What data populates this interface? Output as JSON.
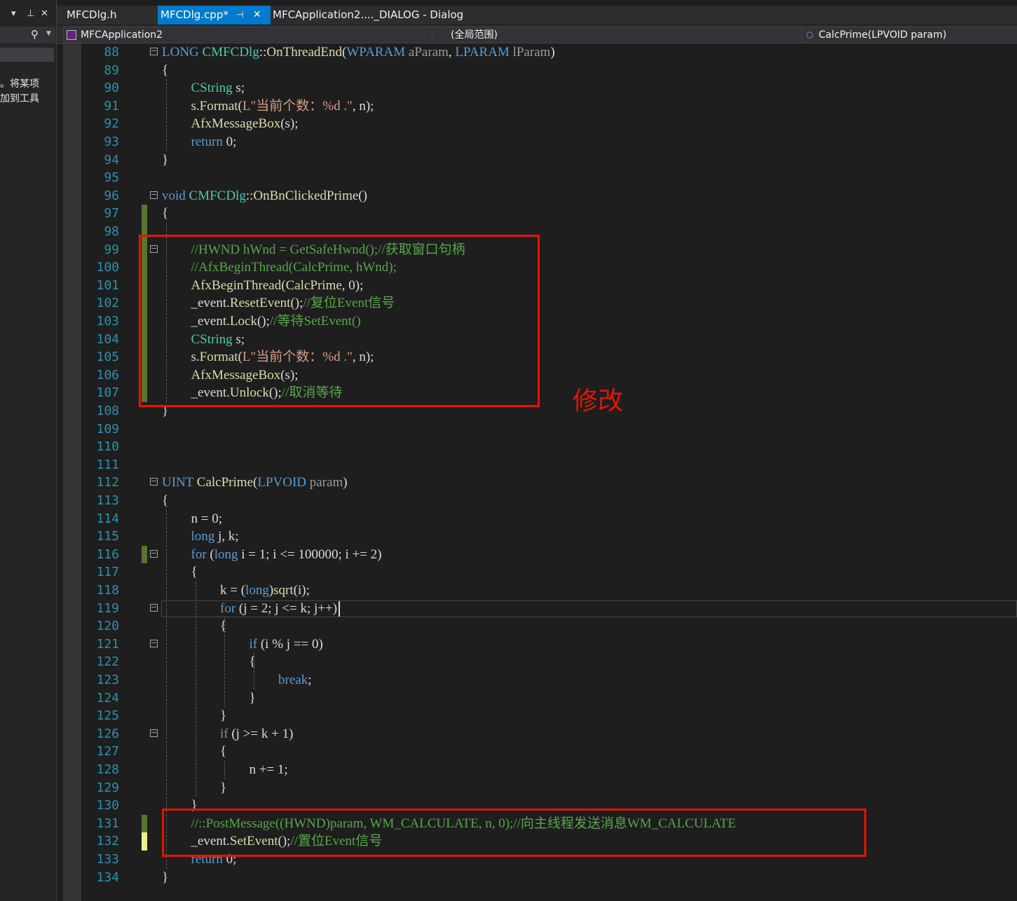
{
  "sidebar": {
    "note_text": "。将某项\n加到工具"
  },
  "tabs": [
    {
      "label": "MFCDlg.h",
      "active": false
    },
    {
      "label": "MFCDlg.cpp*",
      "active": true
    },
    {
      "label": "MFCApplication2...._DIALOG - Dialog",
      "active": false
    }
  ],
  "navbar": {
    "project": "MFCApplication2",
    "scope": "(全局范围)",
    "member": "CalcPrime(LPVOID param)"
  },
  "annotation": {
    "label": "修改",
    "color": "#e51400"
  },
  "colors": {
    "keyword": "#569cd6",
    "type": "#4ec9b0",
    "function": "#dcdcaa",
    "comment": "#57a64a",
    "string": "#d69d85",
    "line_number": "#2b91af",
    "change_saved": "#577430",
    "change_unsaved": "#efef91",
    "accent": "#007acc"
  },
  "code_lines": [
    {
      "n": "88",
      "ind": 0,
      "fold": true,
      "toks": [
        [
          "kw",
          "LONG"
        ],
        [
          "tx",
          " "
        ],
        [
          "ty",
          "CMFCDlg"
        ],
        [
          "tx",
          "::"
        ],
        [
          "fn",
          "OnThreadEnd"
        ],
        [
          "tx",
          "("
        ],
        [
          "kw",
          "WPARAM"
        ],
        [
          "tx",
          " "
        ],
        [
          "pa",
          "aParam"
        ],
        [
          "tx",
          ", "
        ],
        [
          "kw",
          "LPARAM"
        ],
        [
          "tx",
          " "
        ],
        [
          "pa",
          "lParam"
        ],
        [
          "tx",
          ")"
        ]
      ]
    },
    {
      "n": "89",
      "ind": 0,
      "toks": [
        [
          "tx",
          "{"
        ]
      ]
    },
    {
      "n": "90",
      "ind": 1,
      "toks": [
        [
          "ty",
          "CString"
        ],
        [
          "tx",
          " s;"
        ]
      ]
    },
    {
      "n": "91",
      "ind": 1,
      "toks": [
        [
          "tx",
          "s."
        ],
        [
          "fn",
          "Format"
        ],
        [
          "tx",
          "("
        ],
        [
          "st",
          "L\"当前个数：%d .\""
        ],
        [
          "tx",
          ", n);"
        ]
      ]
    },
    {
      "n": "92",
      "ind": 1,
      "toks": [
        [
          "fn",
          "AfxMessageBox"
        ],
        [
          "tx",
          "(s);"
        ]
      ]
    },
    {
      "n": "93",
      "ind": 1,
      "toks": [
        [
          "kw",
          "return"
        ],
        [
          "tx",
          " 0;"
        ]
      ]
    },
    {
      "n": "94",
      "ind": 0,
      "toks": [
        [
          "tx",
          "}"
        ]
      ]
    },
    {
      "n": "95",
      "ind": 0,
      "toks": []
    },
    {
      "n": "96",
      "ind": 0,
      "fold": true,
      "toks": [
        [
          "kw",
          "void"
        ],
        [
          "tx",
          " "
        ],
        [
          "ty",
          "CMFCDlg"
        ],
        [
          "tx",
          "::"
        ],
        [
          "fn",
          "OnBnClickedPrime"
        ],
        [
          "tx",
          "()"
        ]
      ]
    },
    {
      "n": "97",
      "ind": 0,
      "chg": "saved",
      "toks": [
        [
          "tx",
          "{"
        ]
      ]
    },
    {
      "n": "98",
      "ind": 1,
      "chg": "saved",
      "toks": []
    },
    {
      "n": "99",
      "ind": 1,
      "chg": "saved",
      "fold": true,
      "toks": [
        [
          "cm",
          "//HWND hWnd = GetSafeHwnd();//获取窗口句柄"
        ]
      ]
    },
    {
      "n": "100",
      "ind": 1,
      "chg": "saved",
      "toks": [
        [
          "cm",
          "//AfxBeginThread(CalcPrime, hWnd);"
        ]
      ]
    },
    {
      "n": "101",
      "ind": 1,
      "chg": "saved",
      "toks": [
        [
          "fn",
          "AfxBeginThread"
        ],
        [
          "tx",
          "("
        ],
        [
          "fn",
          "CalcPrime"
        ],
        [
          "tx",
          ", 0);"
        ]
      ]
    },
    {
      "n": "102",
      "ind": 1,
      "chg": "saved",
      "toks": [
        [
          "tx",
          "_event."
        ],
        [
          "fn",
          "ResetEvent"
        ],
        [
          "tx",
          "();"
        ],
        [
          "cm",
          "//复位Event信号"
        ]
      ]
    },
    {
      "n": "103",
      "ind": 1,
      "chg": "saved",
      "toks": [
        [
          "tx",
          "_event."
        ],
        [
          "fn",
          "Lock"
        ],
        [
          "tx",
          "();"
        ],
        [
          "cm",
          "//等待SetEvent()"
        ]
      ]
    },
    {
      "n": "104",
      "ind": 1,
      "chg": "saved",
      "toks": [
        [
          "ty",
          "CString"
        ],
        [
          "tx",
          " s;"
        ]
      ]
    },
    {
      "n": "105",
      "ind": 1,
      "chg": "saved",
      "toks": [
        [
          "tx",
          "s."
        ],
        [
          "fn",
          "Format"
        ],
        [
          "tx",
          "("
        ],
        [
          "st",
          "L\"当前个数：%d .\""
        ],
        [
          "tx",
          ", n);"
        ]
      ]
    },
    {
      "n": "106",
      "ind": 1,
      "chg": "saved",
      "toks": [
        [
          "fn",
          "AfxMessageBox"
        ],
        [
          "tx",
          "(s);"
        ]
      ]
    },
    {
      "n": "107",
      "ind": 1,
      "chg": "saved",
      "toks": [
        [
          "tx",
          "_event."
        ],
        [
          "fn",
          "Unlock"
        ],
        [
          "tx",
          "();"
        ],
        [
          "cm",
          "//取消等待"
        ]
      ]
    },
    {
      "n": "108",
      "ind": 0,
      "toks": [
        [
          "tx",
          "}"
        ]
      ]
    },
    {
      "n": "109",
      "ind": 0,
      "toks": []
    },
    {
      "n": "110",
      "ind": 0,
      "toks": []
    },
    {
      "n": "111",
      "ind": 0,
      "toks": []
    },
    {
      "n": "112",
      "ind": 0,
      "fold": true,
      "toks": [
        [
          "kw",
          "UINT"
        ],
        [
          "tx",
          " "
        ],
        [
          "fn",
          "CalcPrime"
        ],
        [
          "tx",
          "("
        ],
        [
          "kw",
          "LPVOID"
        ],
        [
          "tx",
          " "
        ],
        [
          "pa",
          "param"
        ],
        [
          "tx",
          ")"
        ]
      ]
    },
    {
      "n": "113",
      "ind": 0,
      "toks": [
        [
          "tx",
          "{"
        ]
      ]
    },
    {
      "n": "114",
      "ind": 1,
      "toks": [
        [
          "tx",
          "n = 0;"
        ]
      ]
    },
    {
      "n": "115",
      "ind": 1,
      "toks": [
        [
          "kw",
          "long"
        ],
        [
          "tx",
          " j, k;"
        ]
      ]
    },
    {
      "n": "116",
      "ind": 1,
      "chg": "saved",
      "fold": true,
      "toks": [
        [
          "kw",
          "for"
        ],
        [
          "tx",
          " ("
        ],
        [
          "kw",
          "long"
        ],
        [
          "tx",
          " i = 1; i <= 100000; i += 2)"
        ]
      ]
    },
    {
      "n": "117",
      "ind": 1,
      "toks": [
        [
          "tx",
          "{"
        ]
      ]
    },
    {
      "n": "118",
      "ind": 2,
      "toks": [
        [
          "tx",
          "k = ("
        ],
        [
          "kw",
          "long"
        ],
        [
          "tx",
          ")"
        ],
        [
          "fn",
          "sqrt"
        ],
        [
          "tx",
          "(i);"
        ]
      ]
    },
    {
      "n": "119",
      "ind": 2,
      "fold": true,
      "cur": true,
      "toks": [
        [
          "kw",
          "for"
        ],
        [
          "tx",
          " (j = 2; j <= k; j++)"
        ]
      ]
    },
    {
      "n": "120",
      "ind": 2,
      "toks": [
        [
          "tx",
          "{"
        ]
      ]
    },
    {
      "n": "121",
      "ind": 3,
      "fold": true,
      "toks": [
        [
          "kw",
          "if"
        ],
        [
          "tx",
          " (i % j == 0)"
        ]
      ]
    },
    {
      "n": "122",
      "ind": 3,
      "toks": [
        [
          "tx",
          "{"
        ]
      ]
    },
    {
      "n": "123",
      "ind": 4,
      "toks": [
        [
          "kw",
          "break"
        ],
        [
          "tx",
          ";"
        ]
      ]
    },
    {
      "n": "124",
      "ind": 3,
      "toks": [
        [
          "tx",
          "}"
        ]
      ]
    },
    {
      "n": "125",
      "ind": 2,
      "toks": [
        [
          "tx",
          "}"
        ]
      ]
    },
    {
      "n": "126",
      "ind": 2,
      "fold": true,
      "toks": [
        [
          "kw",
          "if"
        ],
        [
          "tx",
          " (j >= k + 1)"
        ]
      ]
    },
    {
      "n": "127",
      "ind": 2,
      "toks": [
        [
          "tx",
          "{"
        ]
      ]
    },
    {
      "n": "128",
      "ind": 3,
      "toks": [
        [
          "tx",
          "n += 1;"
        ]
      ]
    },
    {
      "n": "129",
      "ind": 2,
      "toks": [
        [
          "tx",
          "}"
        ]
      ]
    },
    {
      "n": "130",
      "ind": 1,
      "toks": [
        [
          "tx",
          "}"
        ]
      ]
    },
    {
      "n": "131",
      "ind": 1,
      "chg": "saved",
      "toks": [
        [
          "cm",
          "//::PostMessage((HWND)param, WM_CALCULATE, n, 0);//向主线程发送消息WM_CALCULATE"
        ]
      ]
    },
    {
      "n": "132",
      "ind": 1,
      "chg": "unsaved",
      "toks": [
        [
          "tx",
          "_event."
        ],
        [
          "fn",
          "SetEvent"
        ],
        [
          "tx",
          "();"
        ],
        [
          "cm",
          "//置位Event信号"
        ]
      ]
    },
    {
      "n": "133",
      "ind": 1,
      "toks": [
        [
          "kw",
          "return"
        ],
        [
          "tx",
          " 0;"
        ]
      ]
    },
    {
      "n": "134",
      "ind": 0,
      "toks": [
        [
          "tx",
          "}"
        ]
      ]
    }
  ]
}
